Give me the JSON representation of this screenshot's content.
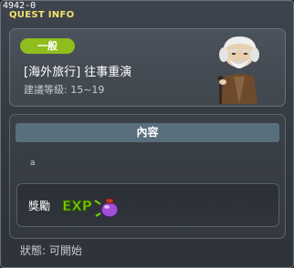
{
  "window": {
    "quest_id": "4942-0",
    "title": "QUEST INFO"
  },
  "quest": {
    "category": "一般",
    "name": "[海外旅行] 往事重演",
    "level": "建議等級: 15~19"
  },
  "content": {
    "header": "內容",
    "body": "a"
  },
  "reward": {
    "label": "獎勵",
    "exp_text": "EXP",
    "icon": "exp-potion-icon"
  },
  "footer": {
    "status": "狀態:  可開始"
  },
  "colors": {
    "title": "#f2e36b",
    "badge": "#8fbd1e",
    "header_bar": "#5a6f7d",
    "exp_green": "#7bd200",
    "exp_purple": "#a34fd8"
  }
}
